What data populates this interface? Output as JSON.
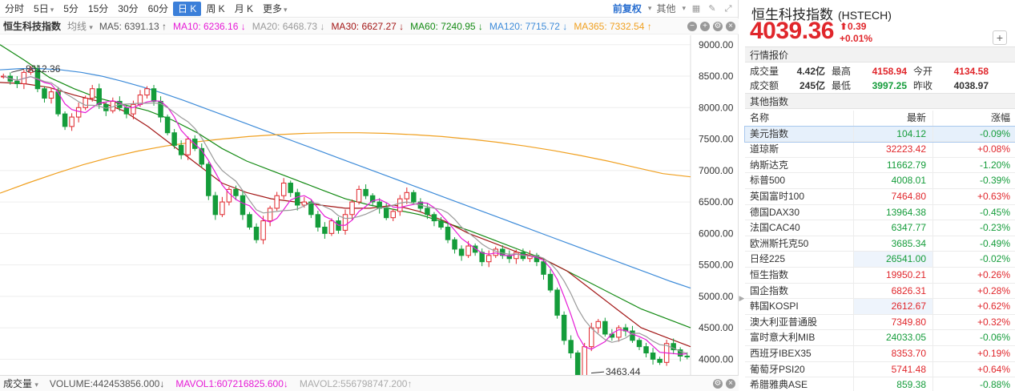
{
  "toolbar": {
    "timeframes": [
      "分时",
      "5日",
      "5分",
      "15分",
      "30分",
      "60分",
      "日 K",
      "周 K",
      "月 K",
      "更多"
    ],
    "active": "日 K",
    "adjust": "前复权",
    "other": "其他"
  },
  "legend": {
    "name": "恒生科技指数",
    "ma_type": "均线",
    "items": [
      {
        "label": "MA5: 6391.13 ↑",
        "color": "#555555"
      },
      {
        "label": "MA10: 6236.16 ↓",
        "color": "#e61bd6"
      },
      {
        "label": "MA20: 6468.73 ↓",
        "color": "#9a9a9a"
      },
      {
        "label": "MA30: 6627.27 ↓",
        "color": "#a31717"
      },
      {
        "label": "MA60: 7240.95 ↓",
        "color": "#138a13"
      },
      {
        "label": "MA120: 7715.72 ↓",
        "color": "#3d8bd9"
      },
      {
        "label": "MA365: 7332.54 ↑",
        "color": "#f0a020"
      }
    ]
  },
  "chart_data": {
    "type": "candlestick",
    "y_ticks": [
      "9000.00",
      "8500.00",
      "8000.00",
      "7500.00",
      "7000.00",
      "6500.00",
      "6000.00",
      "5500.00",
      "5000.00",
      "4500.00",
      "4000.00"
    ],
    "ylim": [
      3750,
      9150
    ],
    "high_label": "8612.36",
    "low_label": "3463.44",
    "close_series": [
      8500,
      8420,
      8380,
      8560,
      8600,
      8300,
      8150,
      8250,
      7900,
      7700,
      7850,
      8000,
      8150,
      8300,
      8050,
      7950,
      8100,
      8000,
      7900,
      8050,
      8200,
      8300,
      8100,
      7850,
      7600,
      7400,
      7250,
      7500,
      7350,
      7100,
      6600,
      6300,
      6500,
      6700,
      6600,
      6300,
      6100,
      5900,
      6200,
      6400,
      6600,
      6800,
      6650,
      6450,
      6500,
      6300,
      6100,
      6000,
      6200,
      6050,
      6300,
      6500,
      6700,
      6600,
      6500,
      6400,
      6250,
      6350,
      6550,
      6650,
      6500,
      6400,
      6300,
      6200,
      6100,
      5900,
      5750,
      5650,
      5800,
      5700,
      5550,
      5650,
      5750,
      5650,
      5600,
      5700,
      5600,
      5650,
      5550,
      5350,
      5100,
      4700,
      4300,
      4100,
      3700,
      4200,
      4500,
      4600,
      4400,
      4350,
      4500,
      4450,
      4300,
      4200,
      4100,
      4000,
      3950,
      4250,
      4150,
      4050,
      4039
    ],
    "ma_paths": [
      {
        "name": "MA120",
        "color": "#3d8bd9",
        "values": [
          8600,
          8620,
          8620,
          8600,
          8560,
          8500,
          8420,
          8330,
          8230,
          8120,
          8000,
          7880,
          7760,
          7640,
          7520,
          7400,
          7280,
          7160,
          7040,
          6920,
          6800,
          6680,
          6560,
          6440,
          6320,
          6200,
          6080,
          5960,
          5840,
          5720,
          5600,
          5480,
          5360,
          5240,
          5130
        ]
      },
      {
        "name": "MA365",
        "color": "#f0a020",
        "values": [
          6640,
          6800,
          6950,
          7090,
          7210,
          7310,
          7390,
          7450,
          7500,
          7540,
          7570,
          7590,
          7600,
          7600,
          7590,
          7570,
          7540,
          7500,
          7450,
          7390,
          7320,
          7240,
          7150,
          7050,
          6950,
          6900
        ]
      },
      {
        "name": "MA60",
        "color": "#138a13",
        "values": [
          9000,
          8750,
          8480,
          8300,
          8150,
          8050,
          7950,
          7800,
          7600,
          7350,
          7150,
          7000,
          6850,
          6700,
          6550,
          6450,
          6380,
          6300,
          6180,
          6050,
          5900,
          5750,
          5600,
          5400,
          5200,
          5000,
          4800,
          4650,
          4500
        ]
      },
      {
        "name": "MA30",
        "color": "#a31717",
        "values": [
          8400,
          8380,
          8320,
          8200,
          8100,
          7950,
          7700,
          7400,
          7100,
          6800,
          6650,
          6550,
          6500,
          6450,
          6400,
          6400,
          6450,
          6350,
          6200,
          6000,
          5850,
          5700,
          5600,
          5400,
          5100,
          4800,
          4500,
          4350,
          4200
        ]
      }
    ]
  },
  "volume": {
    "label": "成交量",
    "vol": "VOLUME:442453856.000↓",
    "mavol1": "MAVOL1:607216825.600↓",
    "mavol2": "MAVOL2:556798747.200↑"
  },
  "quote": {
    "name": "恒生科技指数",
    "code": "(HSTECH)",
    "price": "4039.36",
    "change": "⬆0.39",
    "change_pct": "+0.01%",
    "section": "行情报价",
    "rows": [
      [
        {
          "l": "成交量",
          "v": "4.42亿",
          "c": ""
        },
        {
          "l": "最高",
          "v": "4158.94",
          "c": "red"
        },
        {
          "l": "今开",
          "v": "4134.58",
          "c": "red"
        }
      ],
      [
        {
          "l": "成交额",
          "v": "245亿",
          "c": ""
        },
        {
          "l": "最低",
          "v": "3997.25",
          "c": "green"
        },
        {
          "l": "昨收",
          "v": "4038.97",
          "c": ""
        }
      ]
    ]
  },
  "other_indices": {
    "title": "其他指数",
    "headers": [
      "名称",
      "最新",
      "涨幅"
    ],
    "rows": [
      {
        "name": "美元指数",
        "last": "104.12",
        "chg": "-0.09%",
        "up": false,
        "sel": true
      },
      {
        "name": "道琼斯",
        "last": "32223.42",
        "chg": "+0.08%",
        "up": true
      },
      {
        "name": "纳斯达克",
        "last": "11662.79",
        "chg": "-1.20%",
        "up": false
      },
      {
        "name": "标普500",
        "last": "4008.01",
        "chg": "-0.39%",
        "up": false
      },
      {
        "name": "英国富时100",
        "last": "7464.80",
        "chg": "+0.63%",
        "up": true
      },
      {
        "name": "德国DAX30",
        "last": "13964.38",
        "chg": "-0.45%",
        "up": false
      },
      {
        "name": "法国CAC40",
        "last": "6347.77",
        "chg": "-0.23%",
        "up": false
      },
      {
        "name": "欧洲斯托克50",
        "last": "3685.34",
        "chg": "-0.49%",
        "up": false
      },
      {
        "name": "日经225",
        "last": "26541.00",
        "chg": "-0.02%",
        "up": false,
        "hl": true
      },
      {
        "name": "恒生指数",
        "last": "19950.21",
        "chg": "+0.26%",
        "up": true
      },
      {
        "name": "国企指数",
        "last": "6826.31",
        "chg": "+0.28%",
        "up": true
      },
      {
        "name": "韩国KOSPI",
        "last": "2612.67",
        "chg": "+0.62%",
        "up": true,
        "hl": true
      },
      {
        "name": "澳大利亚普通股",
        "last": "7349.80",
        "chg": "+0.32%",
        "up": true
      },
      {
        "name": "富时意大利MIB",
        "last": "24033.05",
        "chg": "-0.06%",
        "up": false
      },
      {
        "name": "西班牙IBEX35",
        "last": "8353.70",
        "chg": "+0.19%",
        "up": true
      },
      {
        "name": "葡萄牙PSI20",
        "last": "5741.48",
        "chg": "+0.64%",
        "up": true
      },
      {
        "name": "希腊雅典ASE",
        "last": "859.38",
        "chg": "-0.88%",
        "up": false
      }
    ]
  }
}
